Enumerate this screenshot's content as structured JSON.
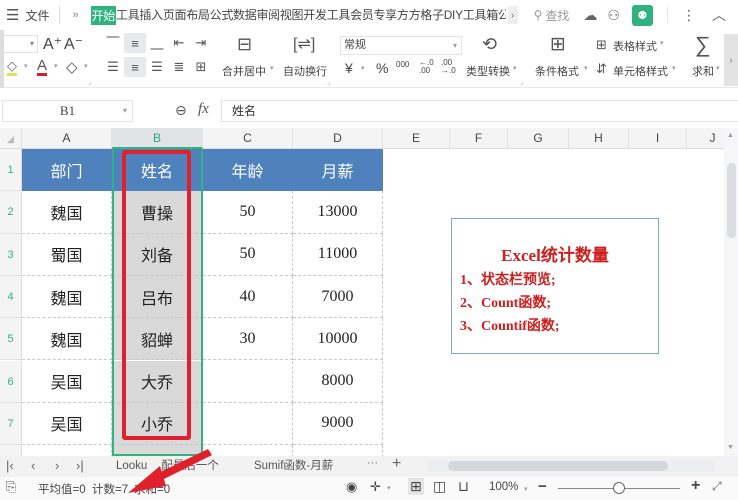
{
  "menubar": {
    "menu_icon": "hamburger-icon",
    "file_label": "文件",
    "more": "»",
    "tabs": [
      "开始",
      "工具",
      "插入",
      "页面布局",
      "公式",
      "数据",
      "审阅",
      "视图",
      "开发工具",
      "会员专享",
      "方方格子",
      "DIY工具箱",
      "公式向导"
    ],
    "active_tab": "开始",
    "search_label": "查找"
  },
  "ribbon": {
    "font_grow": "A⁺",
    "font_shrink": "A⁻",
    "merge_center": "合并居中",
    "auto_wrap": "自动换行",
    "number_format": "常规",
    "currency": "¥",
    "percent": "%",
    "thousands": "000",
    "inc_decimal": "←.0",
    "dec_decimal": ".00",
    "type_convert": "类型转换",
    "conditional_format": "条件格式",
    "table_style": "表格样式",
    "cell_style": "单元格样式",
    "sum": "求和",
    "sigma": "∑"
  },
  "formula_bar": {
    "name_box": "B1",
    "fx": "fx",
    "formula": "姓名"
  },
  "grid": {
    "columns": [
      "A",
      "B",
      "C",
      "D",
      "E",
      "F",
      "G",
      "H",
      "I",
      "J"
    ],
    "selected_column": "B",
    "rows": [
      "1",
      "2",
      "3",
      "4",
      "5",
      "6",
      "7"
    ],
    "table": {
      "headers": [
        "部门",
        "姓名",
        "年龄",
        "月薪"
      ],
      "rows": [
        [
          "魏国",
          "曹操",
          "50",
          "13000"
        ],
        [
          "蜀国",
          "刘备",
          "50",
          "11000"
        ],
        [
          "魏国",
          "吕布",
          "40",
          "7000"
        ],
        [
          "魏国",
          "貂蝉",
          "30",
          "10000"
        ],
        [
          "吴国",
          "大乔",
          "",
          "8000"
        ],
        [
          "吴国",
          "小乔",
          "",
          "9000"
        ]
      ]
    },
    "textbox": {
      "title": "Excel统计数量",
      "lines": [
        "1、状态栏预览;",
        "2、Count函数;",
        "3、Countif函数;"
      ]
    },
    "colors": {
      "header_fill": "#4f81bd",
      "selection": "#2fb380",
      "highlight_box": "#e0202a",
      "textbox_text": "#cc1f1f"
    }
  },
  "sheets": {
    "tabs": [
      "Lookup函数-匹配最后一个",
      "Sumif函数-月薪"
    ],
    "tab1_visible": "Looku",
    "tab1_tail": "配最后一个",
    "more": "···",
    "add": "+"
  },
  "statusbar": {
    "average": "平均值=0",
    "count": "计数=7",
    "sum": "求和=0",
    "zoom": "100%",
    "zoom_out": "−",
    "zoom_in": "+",
    "zoom_level": 0.5
  }
}
